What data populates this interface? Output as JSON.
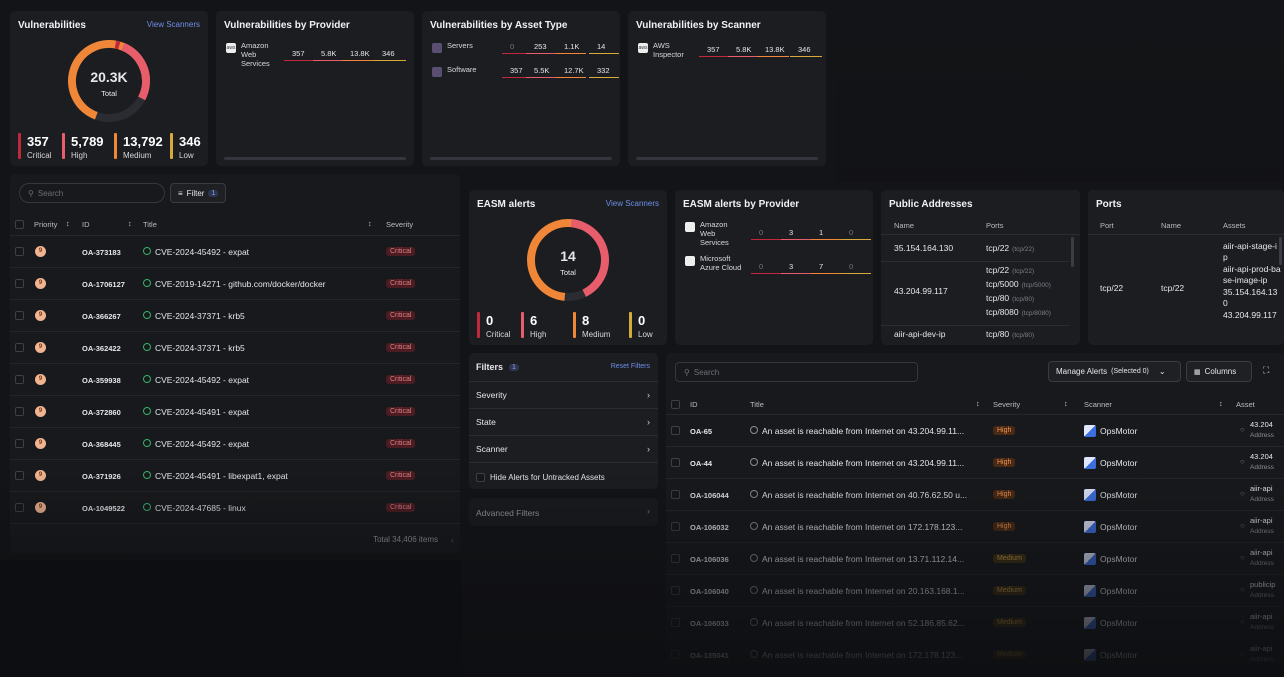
{
  "vuln": {
    "title": "Vulnerabilities",
    "link": "View Scanners",
    "total": "20.3K",
    "total_label": "Total",
    "stats": [
      {
        "value": "357",
        "label": "Critical",
        "color": "#c1273d"
      },
      {
        "value": "5,789",
        "label": "High",
        "color": "#e85d6b"
      },
      {
        "value": "13,792",
        "label": "Medium",
        "color": "#f08637"
      },
      {
        "value": "346",
        "label": "Low",
        "color": "#d7a83a"
      }
    ]
  },
  "vprov": {
    "title": "Vulnerabilities by Provider",
    "rows": [
      {
        "name": "Amazon Web Services",
        "vals": [
          "357",
          "5.8K",
          "13.8K",
          "346"
        ]
      }
    ]
  },
  "vasset": {
    "title": "Vulnerabilities by Asset Type",
    "rows": [
      {
        "name": "Servers",
        "vals": [
          "0",
          "253",
          "1.1K",
          "14"
        ]
      },
      {
        "name": "Software",
        "vals": [
          "357",
          "5.5K",
          "12.7K",
          "332"
        ]
      }
    ]
  },
  "vscan": {
    "title": "Vulnerabilities by Scanner",
    "rows": [
      {
        "name": "AWS Inspector",
        "vals": [
          "357",
          "5.8K",
          "13.8K",
          "346"
        ]
      }
    ]
  },
  "vtable": {
    "search": "Search",
    "filter": "Filter",
    "filter_count": "1",
    "headers": {
      "priority": "Priority",
      "id": "ID",
      "title": "Title",
      "severity": "Severity"
    },
    "rows": [
      {
        "p": "9",
        "id": "OA-373183",
        "title": "CVE-2024-45492 - expat",
        "sev": "Critical"
      },
      {
        "p": "9",
        "id": "OA-1706127",
        "title": "CVE-2019-14271 - github.com/docker/docker",
        "sev": "Critical"
      },
      {
        "p": "9",
        "id": "OA-366267",
        "title": "CVE-2024-37371 - krb5",
        "sev": "Critical"
      },
      {
        "p": "9",
        "id": "OA-362422",
        "title": "CVE-2024-37371 - krb5",
        "sev": "Critical"
      },
      {
        "p": "9",
        "id": "OA-359938",
        "title": "CVE-2024-45492 - expat",
        "sev": "Critical"
      },
      {
        "p": "9",
        "id": "OA-372860",
        "title": "CVE-2024-45491 - expat",
        "sev": "Critical"
      },
      {
        "p": "9",
        "id": "OA-368445",
        "title": "CVE-2024-45492 - expat",
        "sev": "Critical"
      },
      {
        "p": "9",
        "id": "OA-371926",
        "title": "CVE-2024-45491 - libexpat1, expat",
        "sev": "Critical"
      },
      {
        "p": "9",
        "id": "OA-1049522",
        "title": "CVE-2024-47685 - linux",
        "sev": "Critical"
      }
    ],
    "footer": "Total 34,406 items"
  },
  "easm": {
    "title": "EASM alerts",
    "link": "View Scanners",
    "total": "14",
    "total_label": "Total",
    "stats": [
      {
        "value": "0",
        "label": "Critical",
        "color": "#c1273d"
      },
      {
        "value": "6",
        "label": "High",
        "color": "#e85d6b"
      },
      {
        "value": "8",
        "label": "Medium",
        "color": "#f08637"
      },
      {
        "value": "0",
        "label": "Low",
        "color": "#d7a83a"
      }
    ]
  },
  "eprov": {
    "title": "EASM alerts by Provider",
    "rows": [
      {
        "name": "Amazon Web Services",
        "vals": [
          "0",
          "3",
          "1",
          "0"
        ]
      },
      {
        "name": "Microsoft Azure Cloud",
        "vals": [
          "0",
          "3",
          "7",
          "0"
        ]
      }
    ]
  },
  "pub": {
    "title": "Public Addresses",
    "h_name": "Name",
    "h_ports": "Ports",
    "rows": [
      {
        "name": "35.154.164.130",
        "ports": [
          {
            "p": "tcp/22",
            "s": "(tcp/22)"
          }
        ]
      },
      {
        "name": "43.204.99.117",
        "ports": [
          {
            "p": "tcp/22",
            "s": "(tcp/22)"
          },
          {
            "p": "tcp/5000",
            "s": "(tcp/5000)"
          },
          {
            "p": "tcp/80",
            "s": "(tcp/80)"
          },
          {
            "p": "tcp/8080",
            "s": "(tcp/8080)"
          }
        ]
      },
      {
        "name": "aiir-api-dev-ip",
        "ports": [
          {
            "p": "tcp/80",
            "s": "(tcp/80)"
          }
        ]
      }
    ]
  },
  "ports": {
    "title": "Ports",
    "h_port": "Port",
    "h_name": "Name",
    "h_assets": "Assets",
    "port": "tcp/22",
    "name": "tcp/22",
    "assets": [
      "aiir-api-stage-ip",
      "aiir-api-prod-base-image-ip",
      "35.154.164.130",
      "43.204.99.117"
    ]
  },
  "filters": {
    "title": "Filters",
    "count": "1",
    "reset": "Reset Filters",
    "items": [
      "Severity",
      "State",
      "Scanner"
    ],
    "hide": "Hide Alerts for Untracked Assets",
    "advanced": "Advanced Filters"
  },
  "etable": {
    "search": "Search",
    "manage": "Manage Alerts",
    "selected": "(Selected 0)",
    "columns": "Columns",
    "headers": {
      "id": "ID",
      "title": "Title",
      "severity": "Severity",
      "scanner": "Scanner",
      "asset": "Asset"
    },
    "rows": [
      {
        "id": "OA-65",
        "title": "An asset is reachable from Internet on 43.204.99.11...",
        "sev": "High",
        "scanner": "OpsMotor",
        "asset": "43.204",
        "sub": "Address"
      },
      {
        "id": "OA-44",
        "title": "An asset is reachable from Internet on 43.204.99.11...",
        "sev": "High",
        "scanner": "OpsMotor",
        "asset": "43.204",
        "sub": "Address"
      },
      {
        "id": "OA-106044",
        "title": "An asset is reachable from Internet on 40.76.62.50 u...",
        "sev": "High",
        "scanner": "OpsMotor",
        "asset": "aiir-api",
        "sub": "Address"
      },
      {
        "id": "OA-106032",
        "title": "An asset is reachable from Internet on 172.178.123...",
        "sev": "High",
        "scanner": "OpsMotor",
        "asset": "aiir-api",
        "sub": "Address"
      },
      {
        "id": "OA-106036",
        "title": "An asset is reachable from Internet on 13.71.112.14...",
        "sev": "Medium",
        "scanner": "OpsMotor",
        "asset": "aiir-api",
        "sub": "Address"
      },
      {
        "id": "OA-106040",
        "title": "An asset is reachable from Internet on 20.163.168.1...",
        "sev": "Medium",
        "scanner": "OpsMotor",
        "asset": "publicip",
        "sub": "Address"
      },
      {
        "id": "OA-106033",
        "title": "An asset is reachable from Internet on 52.186.85.62...",
        "sev": "Medium",
        "scanner": "OpsMotor",
        "asset": "aiir-api",
        "sub": "Address"
      },
      {
        "id": "OA-135041",
        "title": "An asset is reachable from Internet on 172.178.123...",
        "sev": "Medium",
        "scanner": "OpsMotor",
        "asset": "aiir-api",
        "sub": "Address"
      }
    ]
  }
}
